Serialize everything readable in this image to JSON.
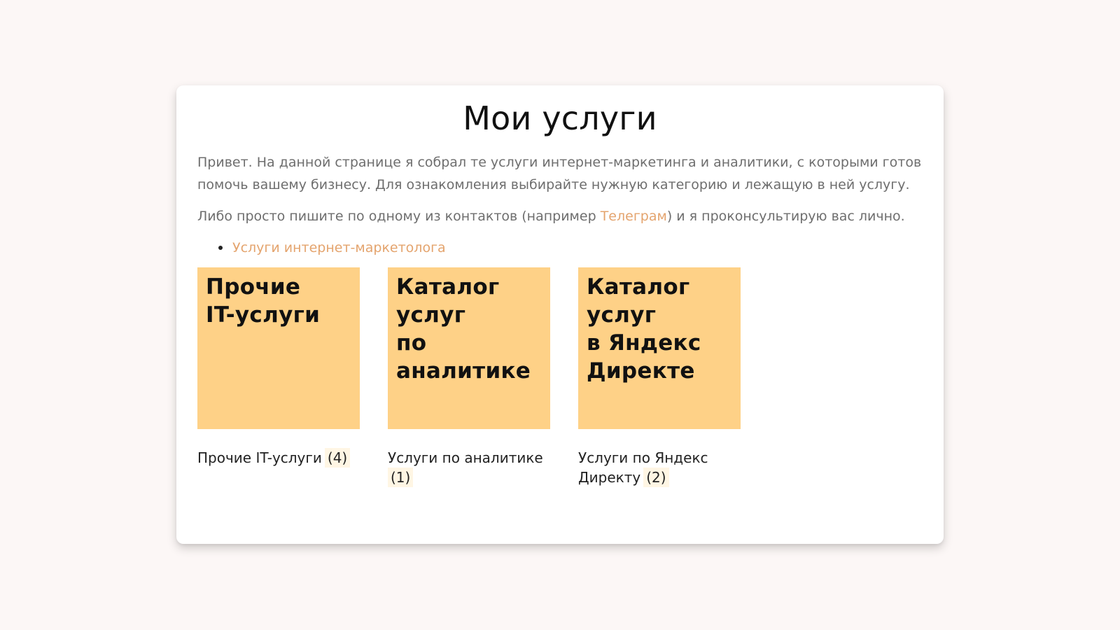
{
  "page": {
    "title": "Мои услуги",
    "intro": "Привет. На данной странице я собрал те услуги интернет-маркетинга и аналитики, с которыми готов помочь вашему бизнесу. Для ознакомления выбирайте нужную категорию и лежащую в ней услугу.",
    "contact_before": "Либо просто пишите по одному из контактов (например ",
    "contact_link": "Телеграм",
    "contact_after": ") и я проконсультирую вас лично."
  },
  "categories": [
    {
      "label": "Услуги интернет-маркетолога"
    }
  ],
  "tiles": [
    {
      "image_text": "Прочие\nIT-услуги",
      "caption": "Прочие IT-услуги",
      "count": "(4)"
    },
    {
      "image_text": "Каталог\nуслуг\nпо\nаналитике",
      "caption": "Услуги по аналитике",
      "count": "(1)"
    },
    {
      "image_text": "Каталог\nуслуг\nв Яндекс\nДиректе",
      "caption": "Услуги по Яндекс Директу",
      "count": "(2)"
    }
  ],
  "colors": {
    "background": "#fcf7f6",
    "card": "#ffffff",
    "accent": "#e4a46e",
    "tile": "#fed187",
    "badge": "#fff6e4"
  }
}
